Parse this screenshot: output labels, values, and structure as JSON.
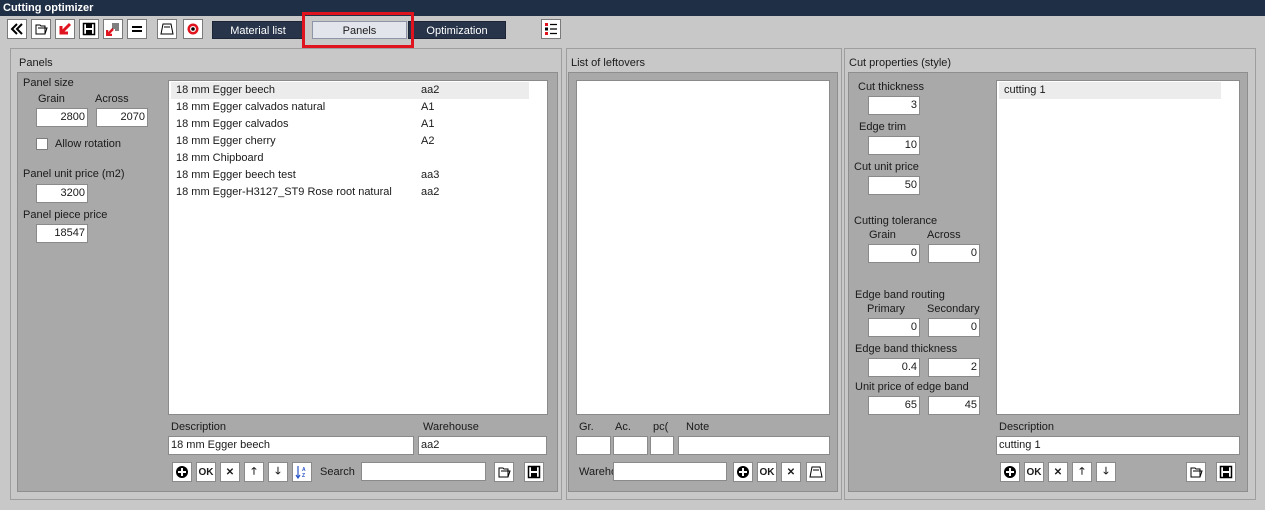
{
  "window": {
    "title": "Cutting optimizer"
  },
  "tabs": {
    "material_list": "Material list",
    "panels": "Panels",
    "optimization": "Optimization"
  },
  "panels": {
    "header": "Panels",
    "panel_size_label": "Panel size",
    "grain_label": "Grain",
    "across_label": "Across",
    "grain_value": "2800",
    "across_value": "2070",
    "allow_rotation_label": "Allow rotation",
    "allow_rotation_checked": false,
    "unit_price_label": "Panel unit price (m2)",
    "unit_price_value": "3200",
    "piece_price_label": "Panel piece price",
    "piece_price_value": "18547",
    "items": [
      {
        "name": "18 mm Egger beech",
        "code": "aa2"
      },
      {
        "name": "18 mm Egger calvados natural",
        "code": "A1"
      },
      {
        "name": "18 mm Egger calvados",
        "code": "A1"
      },
      {
        "name": "18 mm Egger cherry",
        "code": "A2"
      },
      {
        "name": "18 mm Chipboard",
        "code": ""
      },
      {
        "name": "18 mm Egger beech test",
        "code": "aa3"
      },
      {
        "name": "18 mm Egger-H3127_ST9 Rose root natural",
        "code": "aa2"
      }
    ],
    "description_label": "Description",
    "warehouse_label": "Warehouse",
    "description_value": "18 mm Egger beech",
    "warehouse_value": "aa2",
    "search_label": "Search",
    "search_value": ""
  },
  "leftovers": {
    "header": "List of leftovers",
    "gr_label": "Gr.",
    "ac_label": "Ac.",
    "pc_label": "pc(",
    "note_label": "Note",
    "warehouse_label": "Wareho",
    "gr_value": "",
    "ac_value": "",
    "pc_value": "",
    "note_value": "",
    "warehouse_value": ""
  },
  "cut": {
    "header": "Cut properties (style)",
    "cut_thickness_label": "Cut thickness",
    "cut_thickness_value": "3",
    "edge_trim_label": "Edge trim",
    "edge_trim_value": "10",
    "cut_unit_price_label": "Cut unit price",
    "cut_unit_price_value": "50",
    "tolerance_label": "Cutting tolerance",
    "tol_grain_label": "Grain",
    "tol_across_label": "Across",
    "tol_grain_value": "0",
    "tol_across_value": "0",
    "routing_label": "Edge band routing",
    "primary_label": "Primary",
    "secondary_label": "Secondary",
    "primary_value": "0",
    "secondary_value": "0",
    "band_thickness_label": "Edge band thickness",
    "band_thickness_1": "0.4",
    "band_thickness_2": "2",
    "band_price_label": "Unit price of edge band",
    "band_price_1": "65",
    "band_price_2": "45",
    "styles": [
      "cutting 1"
    ],
    "description_label": "Description",
    "description_value": "cutting 1"
  },
  "icons": {
    "ok_text": "OK",
    "cancel_text": "✕",
    "up_text": "🡑",
    "down_text": "🡓",
    "colors": {
      "titlebar": "#1f2f46",
      "tab": "#27344a",
      "highlight": "#e0141e",
      "arrow_red": "#e0141e"
    }
  }
}
